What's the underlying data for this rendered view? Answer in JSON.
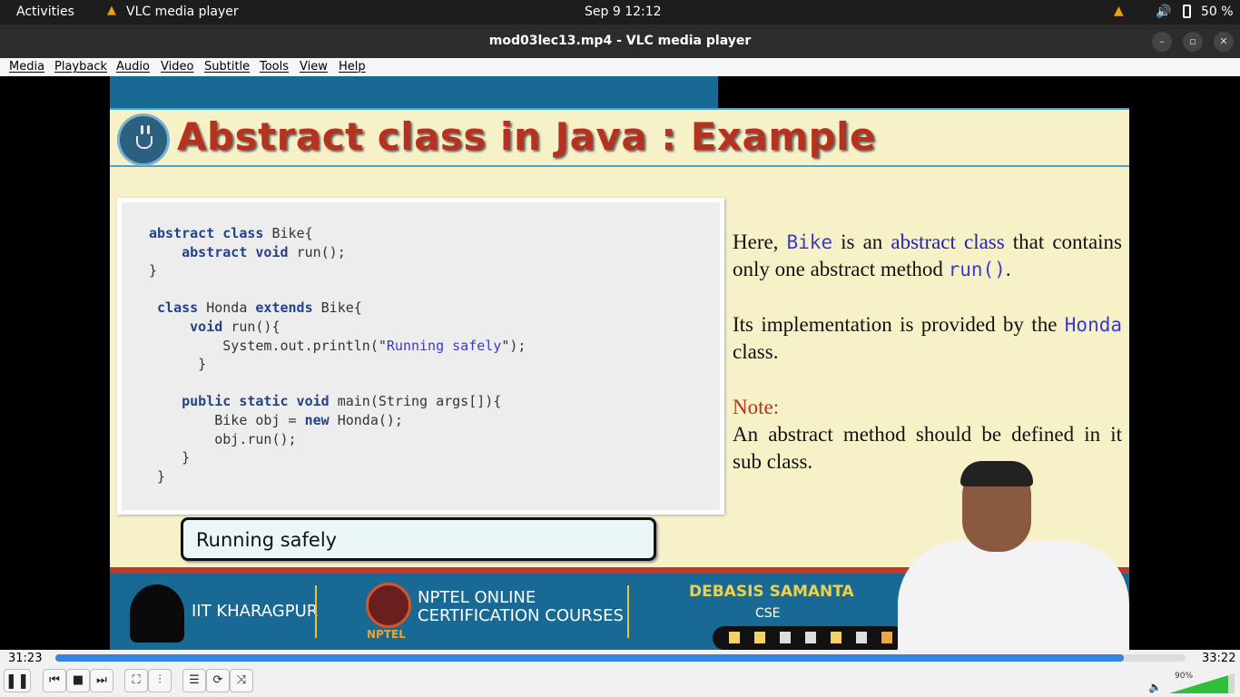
{
  "topbar": {
    "activities": "Activities",
    "app_name": "VLC media player",
    "datetime": "Sep 9  12:12",
    "battery": "50 %"
  },
  "window": {
    "title": "mod03lec13.mp4 - VLC media player"
  },
  "menu": [
    "Media",
    "Playback",
    "Audio",
    "Video",
    "Subtitle",
    "Tools",
    "View",
    "Help"
  ],
  "slide": {
    "title": "Abstract class in Java : Example",
    "code": [
      [
        {
          "t": "abstract class ",
          "k": 1
        },
        {
          "t": "Bike{"
        }
      ],
      [
        {
          "t": "    abstract void ",
          "k": 1
        },
        {
          "t": "run();"
        }
      ],
      [
        {
          "t": "}"
        }
      ],
      [
        {
          "t": ""
        }
      ],
      [
        {
          "t": " class ",
          "k": 1
        },
        {
          "t": "Honda "
        },
        {
          "t": "extends ",
          "k": 1
        },
        {
          "t": "Bike{"
        }
      ],
      [
        {
          "t": "     void ",
          "k": 1
        },
        {
          "t": "run(){"
        }
      ],
      [
        {
          "t": "         System.out.println(\""
        },
        {
          "t": "Running safely",
          "s": 1
        },
        {
          "t": "\");"
        }
      ],
      [
        {
          "t": "      }"
        }
      ],
      [
        {
          "t": ""
        }
      ],
      [
        {
          "t": "    public static void ",
          "k": 1
        },
        {
          "t": "main(String args[]){"
        }
      ],
      [
        {
          "t": "        Bike obj = "
        },
        {
          "t": "new ",
          "k": 1
        },
        {
          "t": "Honda();"
        }
      ],
      [
        {
          "t": "        obj.run();"
        }
      ],
      [
        {
          "t": "    }"
        }
      ],
      [
        {
          "t": " }"
        }
      ]
    ],
    "output": "Running safely",
    "para1": {
      "a": "Here, ",
      "b": "Bike",
      "c": " is an ",
      "d": "abstract class",
      "e": " that contains only one abstract method ",
      "f": "run()",
      "g": "."
    },
    "para2": {
      "a": "Its implementation is provided by the ",
      "b": "Honda",
      "c": " class."
    },
    "note_label": "Note:",
    "note_text": "An abstract method should be defined in it sub class.",
    "footer": {
      "institute": "IIT KHARAGPUR",
      "nptel_line1": "NPTEL ONLINE",
      "nptel_line2": "CERTIFICATION COURSES",
      "nptel_logo_text": "NPTEL",
      "presenter": "DEBASIS SAMANTA",
      "dept": "CSE"
    }
  },
  "player": {
    "elapsed": "31:23",
    "total": "33:22",
    "progress": 0.945,
    "volume_label": "90%",
    "volume": 0.9
  },
  "colors": {
    "accent": "#3584e4",
    "slide_title": "#b4321e",
    "keyword": "#23428a",
    "slide_band": "#186a95"
  }
}
